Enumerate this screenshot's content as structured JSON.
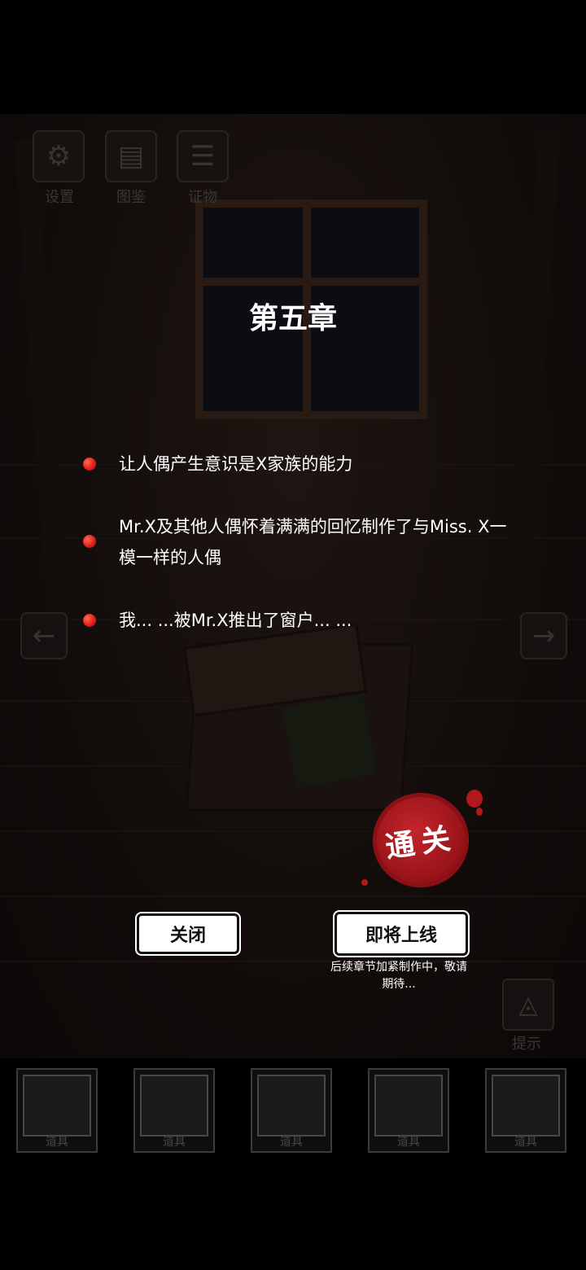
{
  "toolbar": {
    "settings_label": "设置",
    "gallery_label": "图鉴",
    "evidence_label": "证物",
    "settings_icon": "gear-icon",
    "gallery_icon": "notebook-icon",
    "evidence_icon": "notepad-icon"
  },
  "chapter": {
    "title": "第五章",
    "points": [
      "让人偶产生意识是X家族的能力",
      "Mr.X及其他人偶怀着满满的回忆制作了与Miss. X一模一样的人偶",
      "我... ...被Mr.X推出了窗户... ..."
    ]
  },
  "stamp": {
    "text": "通关",
    "color": "#a81a20"
  },
  "buttons": {
    "close_label": "关闭",
    "coming_soon_label": "即将上线",
    "coming_soon_note": "后续章节加紧制作中，敬请期待..."
  },
  "hint": {
    "label": "提示",
    "icon": "eye-triangle-icon"
  },
  "inventory": {
    "slots": [
      "道具",
      "道具",
      "道具",
      "道具",
      "道具"
    ]
  },
  "navigation": {
    "prev_icon": "arrow-left-icon",
    "next_icon": "arrow-right-icon"
  }
}
